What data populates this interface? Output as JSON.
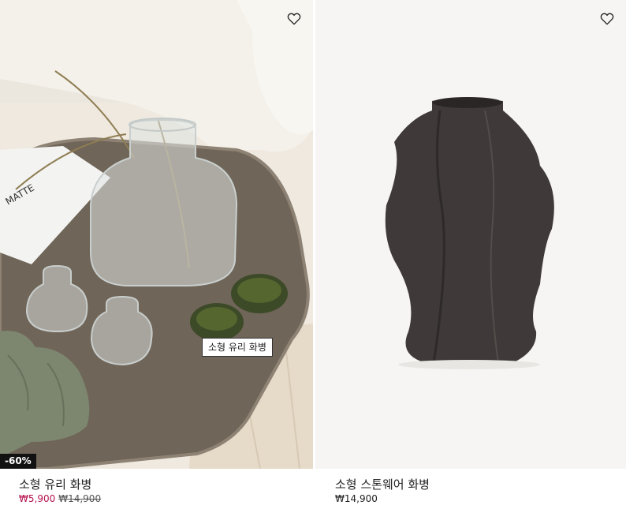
{
  "products": [
    {
      "name": "소형 유리 화병",
      "tag": "소형 유리 화병",
      "discount_badge": "-60%",
      "sale_price": "₩5,900",
      "original_price": "₩14,900",
      "image_icon": "glass-vase-photo"
    },
    {
      "name": "소형 스톤웨어 화병",
      "price": "₩14,900",
      "image_icon": "stoneware-vase-photo"
    }
  ],
  "icons": {
    "favorite": "heart-icon"
  },
  "colors": {
    "sale": "#b4134e",
    "badge_bg": "#111111"
  }
}
